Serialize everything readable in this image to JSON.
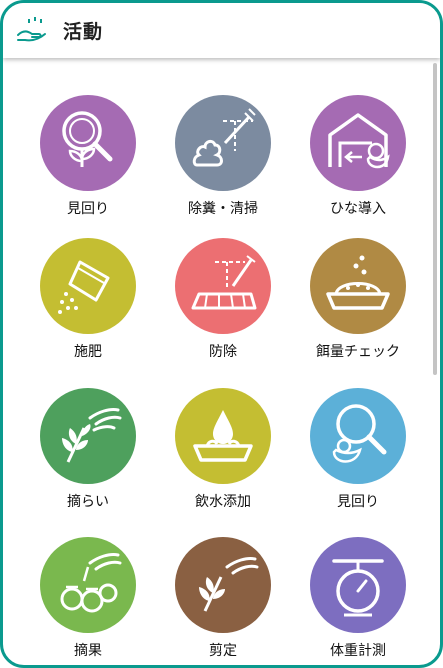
{
  "header": {
    "title": "活動",
    "icon": "hand-sparkle-icon",
    "accent": "#0a9a8e"
  },
  "items": [
    {
      "label": "見回り",
      "icon": "magnifier-sprout-icon",
      "color": "#a56bb3"
    },
    {
      "label": "除糞・清掃",
      "icon": "droppings-spray-icon",
      "color": "#7c8ba0"
    },
    {
      "label": "ひな導入",
      "icon": "house-chick-icon",
      "color": "#a56bb3"
    },
    {
      "label": "施肥",
      "icon": "fertilizer-bag-icon",
      "color": "#c4be32"
    },
    {
      "label": "防除",
      "icon": "field-spray-icon",
      "color": "#ec6f72"
    },
    {
      "label": "餌量チェック",
      "icon": "feed-bowl-icon",
      "color": "#b08a44"
    },
    {
      "label": "摘らい",
      "icon": "hand-sprig-icon",
      "color": "#4ea05d"
    },
    {
      "label": "飲水添加",
      "icon": "water-drop-icon",
      "color": "#c4be32"
    },
    {
      "label": "見回り",
      "icon": "magnifier-chick-icon",
      "color": "#5cb0d8"
    },
    {
      "label": "摘果",
      "icon": "hand-tomato-icon",
      "color": "#7ab84e"
    },
    {
      "label": "剪定",
      "icon": "hand-sprig-icon",
      "color": "#8a6042"
    },
    {
      "label": "体重計測",
      "icon": "scale-icon",
      "color": "#7d6ec0"
    }
  ]
}
